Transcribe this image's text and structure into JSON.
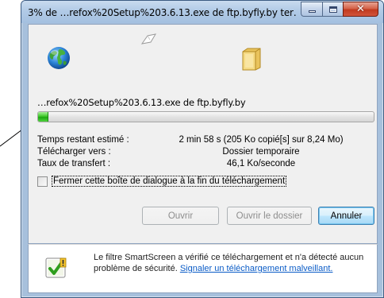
{
  "window": {
    "title": "3% de …refox%20Setup%203.6.13.exe de ftp.byfly.by ter…",
    "close_glyph": "✕"
  },
  "download": {
    "filename": "…refox%20Setup%203.6.13.exe de ftp.byfly.by",
    "progress": 0.03,
    "rows": [
      {
        "label": "Temps restant estimé :",
        "value": "2 min 58 s (205 Ko copié[s] sur 8,24 Mo)"
      },
      {
        "label": "Télécharger vers :",
        "value": "Dossier temporaire"
      },
      {
        "label": "Taux de transfert :",
        "value": "46,1 Ko/seconde"
      }
    ],
    "close_on_complete_label": "Fermer cette boîte de dialogue à la fin du téléchargement",
    "close_on_complete_checked": false
  },
  "buttons": {
    "open": "Ouvrir",
    "open_folder": "Ouvrir le dossier",
    "cancel": "Annuler"
  },
  "footer": {
    "text_before_link": "Le filtre SmartScreen a vérifié ce téléchargement et n'a détecté aucun problème de sécurité. ",
    "link": "Signaler un téléchargement malveillant."
  },
  "colors": {
    "progress_green": "#1da712",
    "link_blue": "#0b5cc7",
    "close_red": "#c13a1f"
  }
}
